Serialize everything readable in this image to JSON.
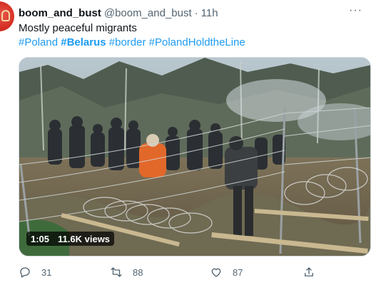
{
  "tweet": {
    "display_name": "boom_and_bust",
    "handle": "@boom_and_bust",
    "separator": "·",
    "time": "11h",
    "more": "···",
    "text": "Mostly peaceful migrants",
    "hashtags": [
      "#Poland",
      "#Belarus",
      "#border",
      "#PolandHoldtheLine"
    ],
    "hashtag_bold_index": 1
  },
  "video": {
    "duration": "1:05",
    "views": "11.6K views"
  },
  "actions": {
    "reply_count": "31",
    "retweet_count": "88",
    "like_count": "87"
  },
  "colors": {
    "link": "#1d9bf0",
    "muted": "#536471",
    "text": "#0f1419",
    "avatar": "#d42e22"
  },
  "icons": [
    "reply-icon",
    "retweet-icon",
    "like-icon",
    "share-icon",
    "more-icon"
  ]
}
